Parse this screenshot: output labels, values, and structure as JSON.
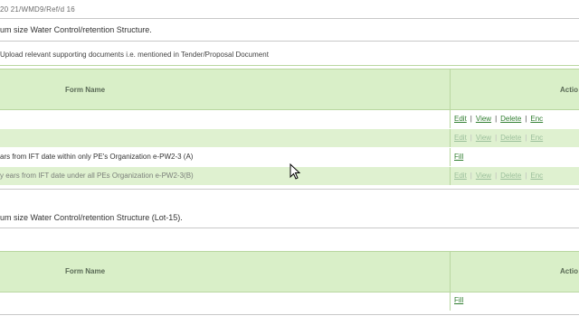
{
  "top_id": "20 21/WMD9/Ref/d 16",
  "section1": {
    "title": "um size Water Control/retention Structure.",
    "upload_note": "Upload relevant supporting documents i.e. mentioned in Tender/Proposal Document"
  },
  "table1": {
    "headers": {
      "form_name": "Form Name",
      "action": "Actio"
    },
    "rows": [
      {
        "text": "",
        "actions": [
          "Edit",
          "View",
          "Delete",
          "Enc"
        ]
      },
      {
        "text": "",
        "actions": [
          "Edit",
          "View",
          "Delete",
          "Enc"
        ]
      },
      {
        "text": "ars from IFT date within only PE's Organization e-PW2-3 (A)",
        "fill": "Fill"
      },
      {
        "text": "y ears from IFT date under all PEs Organization e-PW2-3(B)",
        "actions": [
          "Edit",
          "View",
          "Delete",
          "Enc"
        ]
      }
    ]
  },
  "section2": {
    "title": "um size Water Control/retention Structure (Lot-15)."
  },
  "table2": {
    "headers": {
      "form_name": "Form Name",
      "action": "Actio"
    },
    "rows": [
      {
        "text": "",
        "fill": "Fill"
      }
    ]
  }
}
